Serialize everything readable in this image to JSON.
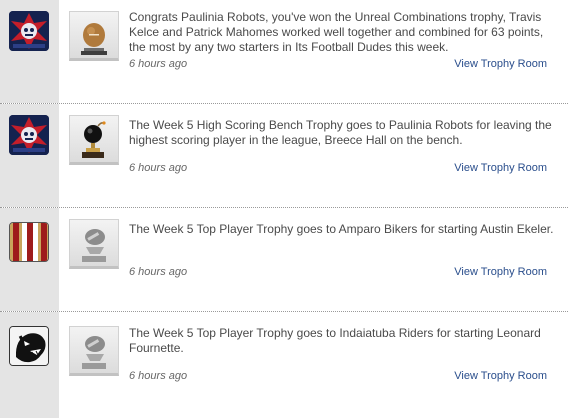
{
  "feed": [
    {
      "team_avatar": "team-logo-robots",
      "trophy_icon": "football-trophy-icon",
      "message": "Congrats Paulinia Robots, you've won the Unreal Combinations trophy, Travis Kelce and Patrick Mahomes worked well together and combined for 63 points, the most by any two starters in Its Football Dudes this week.",
      "time": "6 hours ago",
      "link_label": "View Trophy Room"
    },
    {
      "team_avatar": "team-logo-robots",
      "trophy_icon": "bomb-trophy-icon",
      "message": "The Week 5 High Scoring Bench Trophy goes to Paulinia Robots for leaving the highest scoring player in the league, Breece Hall on the bench.",
      "time": "6 hours ago",
      "link_label": "View Trophy Room"
    },
    {
      "team_avatar": "team-logo-stripes",
      "trophy_icon": "player-trophy-icon",
      "message": "The Week 5 Top Player Trophy goes to Amparo Bikers for starting Austin Ekeler.",
      "time": "6 hours ago",
      "link_label": "View Trophy Room"
    },
    {
      "team_avatar": "team-logo-panther",
      "trophy_icon": "player-trophy-icon",
      "message": "The Week 5 Top Player Trophy goes to Indaiatuba Riders for starting Leonard Fournette.",
      "time": "6 hours ago",
      "link_label": "View Trophy Room"
    }
  ],
  "colors": {
    "link": "#2a4e8c",
    "sidebar": "#e4e4e4",
    "stripe_red": "#9e1b1b",
    "stripe_gold": "#c9a55c"
  }
}
